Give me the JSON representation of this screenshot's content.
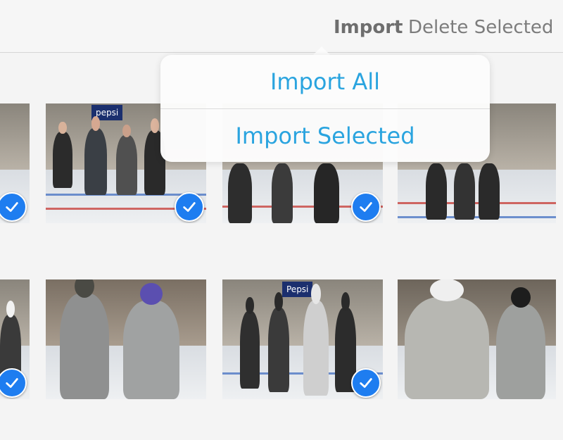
{
  "toolbar": {
    "import_label": "Import",
    "delete_label": "Delete Selected"
  },
  "import_menu": {
    "items": [
      {
        "label": "Import All"
      },
      {
        "label": "Import Selected"
      }
    ]
  },
  "photos": {
    "row1": [
      {
        "selected": true,
        "banner": ""
      },
      {
        "selected": true,
        "banner": "pepsi"
      },
      {
        "selected": true,
        "banner": ""
      },
      {
        "selected": false,
        "banner": ""
      }
    ],
    "row2": [
      {
        "selected": true,
        "banner": ""
      },
      {
        "selected": false,
        "banner": ""
      },
      {
        "selected": true,
        "banner": "Pepsi"
      },
      {
        "selected": false,
        "banner": ""
      }
    ]
  },
  "colors": {
    "accent": "#2aa4df",
    "check_fill": "#1e7df0"
  }
}
